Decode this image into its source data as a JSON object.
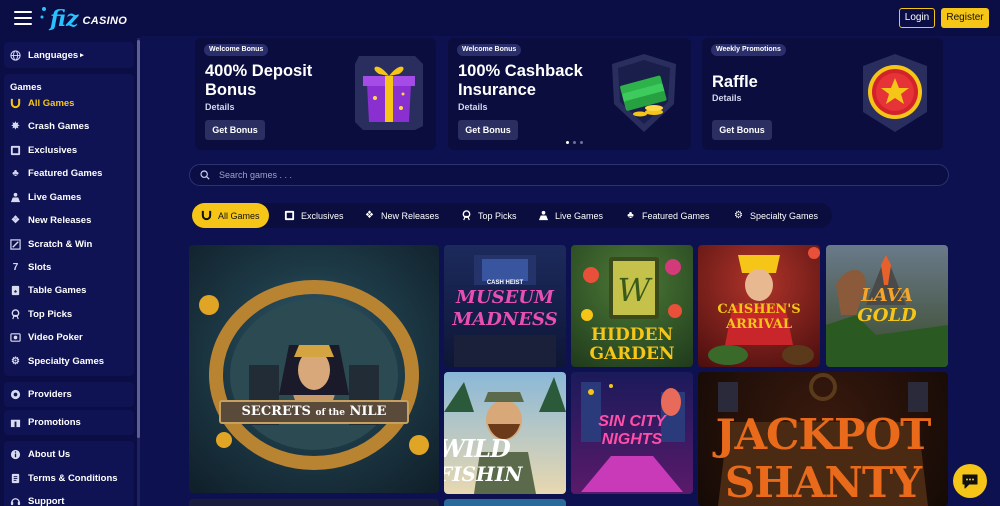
{
  "header": {
    "logo_main": "fiz",
    "logo_sub": "CASINO",
    "login_label": "Login",
    "register_label": "Register",
    "accent": "#f5c518"
  },
  "sidebar": {
    "languages_label": "Languages",
    "languages_arrow": "▸",
    "games_heading": "Games",
    "games": [
      {
        "label": "All Games",
        "icon": "horseshoe-icon",
        "active": true
      },
      {
        "label": "Crash Games",
        "icon": "explosion-icon"
      },
      {
        "label": "Exclusives",
        "icon": "exclusive-icon"
      },
      {
        "label": "Featured Games",
        "icon": "clover-icon"
      },
      {
        "label": "Live Games",
        "icon": "live-dealer-icon"
      },
      {
        "label": "New Releases",
        "icon": "new-releases-icon"
      },
      {
        "label": "Scratch & Win",
        "icon": "scratch-icon"
      },
      {
        "label": "Slots",
        "icon": "seven-icon"
      },
      {
        "label": "Table Games",
        "icon": "cards-icon"
      },
      {
        "label": "Top Picks",
        "icon": "trophy-icon"
      },
      {
        "label": "Video Poker",
        "icon": "poker-chip-icon"
      },
      {
        "label": "Specialty Games",
        "icon": "gear-icon"
      }
    ],
    "providers_label": "Providers",
    "promotions_label": "Promotions",
    "info": [
      {
        "label": "About Us",
        "icon": "info-icon"
      },
      {
        "label": "Terms & Conditions",
        "icon": "document-icon"
      },
      {
        "label": "Support",
        "icon": "support-icon"
      }
    ]
  },
  "promos": [
    {
      "tag": "Welcome Bonus",
      "title": "400% Deposit Bonus",
      "details": "Details",
      "button": "Get Bonus",
      "image": "gift-box-icon"
    },
    {
      "tag": "Welcome Bonus",
      "title": "100% Cashback Insurance",
      "details": "Details",
      "button": "Get Bonus",
      "image": "money-stack-icon"
    },
    {
      "tag": "Weekly Promotions",
      "title": "Raffle",
      "details": "Details",
      "button": "Get Bonus",
      "image": "star-coin-icon"
    }
  ],
  "search": {
    "placeholder": "Search games . . ."
  },
  "categories": [
    {
      "label": "All Games",
      "icon": "horseshoe-icon",
      "active": true
    },
    {
      "label": "Exclusives",
      "icon": "exclusive-icon"
    },
    {
      "label": "New Releases",
      "icon": "new-releases-icon"
    },
    {
      "label": "Top Picks",
      "icon": "trophy-icon"
    },
    {
      "label": "Live Games",
      "icon": "live-dealer-icon"
    },
    {
      "label": "Featured Games",
      "icon": "clover-icon"
    },
    {
      "label": "Specialty Games",
      "icon": "gear-icon"
    }
  ],
  "games": [
    {
      "line1": "SECRETS",
      "line2": "of the",
      "line3": "NILE"
    },
    {
      "line0": "CASH HEIST",
      "line1": "MUSEUM",
      "line2": "MADNESS"
    },
    {
      "line1": "HIDDEN",
      "line2": "GARDEN"
    },
    {
      "line1": "CAISHEN'S",
      "line2": "ARRIVAL"
    },
    {
      "line1": "LAVA",
      "line2": "GOLD"
    },
    {
      "line1": "WILD",
      "line2": "FISHIN"
    },
    {
      "line1": "SIN CITY",
      "line2": "NIGHTS"
    },
    {
      "line1": "JACKPOT",
      "line2": "SHANTY"
    }
  ]
}
